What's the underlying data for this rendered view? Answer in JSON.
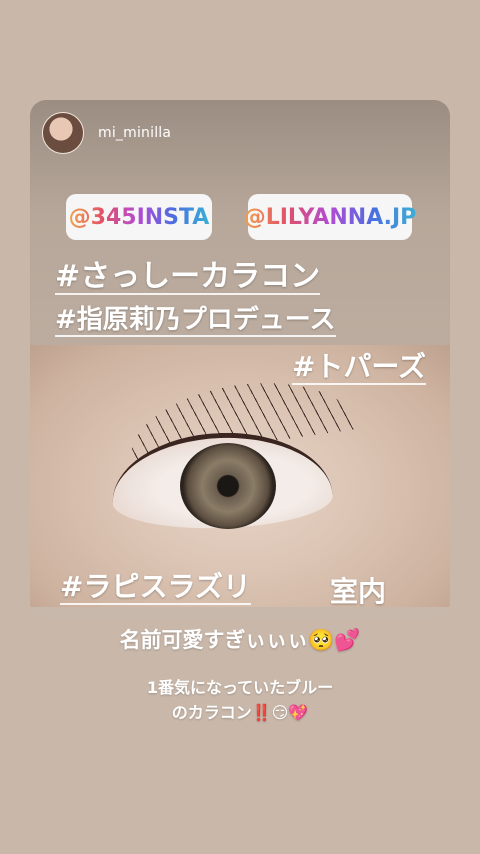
{
  "story": {
    "username": "mi_minilla",
    "mentions": [
      "@345INSTA",
      "@LILYANNA.JP"
    ],
    "hashtags": [
      "#さっしーカラコン",
      "#指原莉乃プロデュース",
      "#トパーズ",
      "#ラピスラズリ"
    ],
    "room_label": "室内",
    "caption_line1": "名前可愛すぎぃぃぃ🥺💕",
    "caption_line2a": "1番気になっていたブルー",
    "caption_line2b": "のカラコン‼️😏💖"
  }
}
